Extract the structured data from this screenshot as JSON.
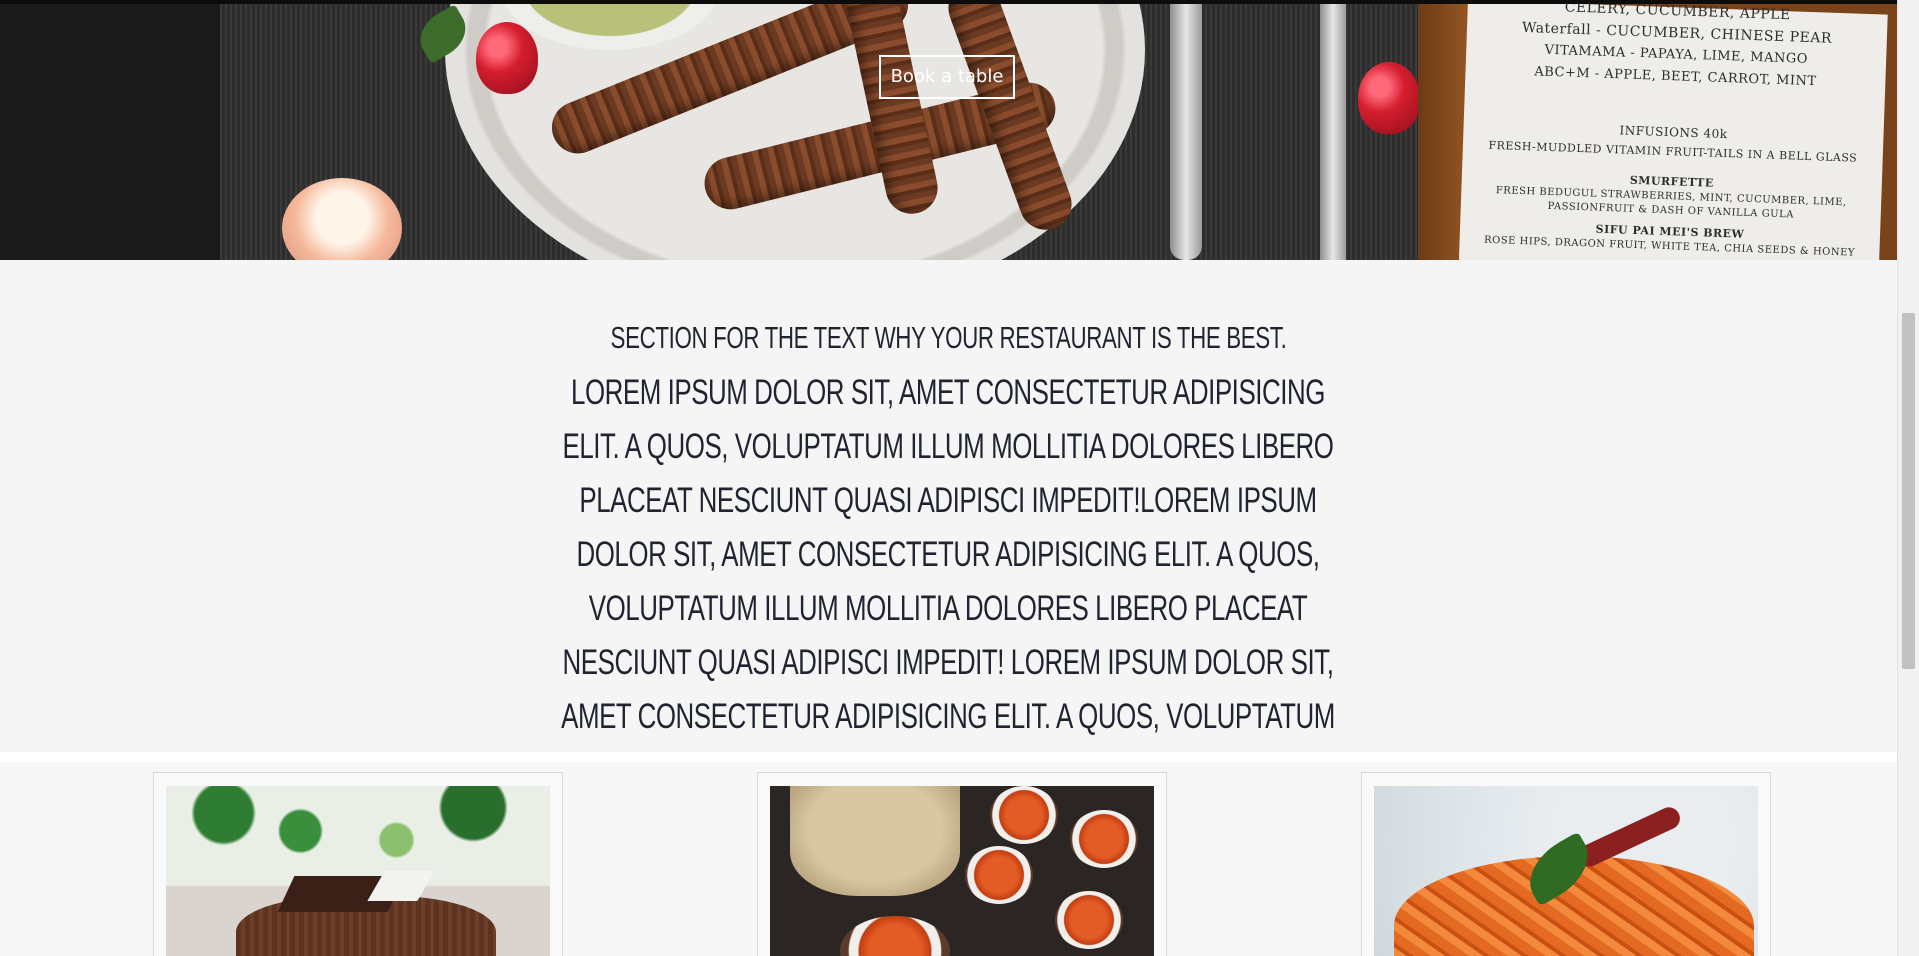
{
  "hero": {
    "book_button_label": "Book a table",
    "menu_lines": [
      "CELERY, CUCUMBER, APPLE",
      "Waterfall - CUCUMBER, CHINESE PEAR",
      "VITAMAMA - PAPAYA, LIME, MANGO",
      "ABC+M - APPLE, BEET, CARROT, MINT",
      "INFUSIONS  40k",
      "FRESH-MUDDLED VITAMIN FRUIT-TAILS IN A BELL GLASS",
      "SMURFETTE",
      "FRESH BEDUGUL STRAWBERRIES, MINT, CUCUMBER, LIME,",
      "PASSIONFRUIT & DASH OF VANILLA GULA",
      "SIFU PAI MEI'S BREW",
      "ROSE HIPS, DRAGON FRUIT, WHITE TEA, CHIA SEEDS & HONEY"
    ]
  },
  "about": {
    "heading": "Section for the text why your restaurant is the best.",
    "body": "Lorem ipsum dolor sit, amet consectetur adipisicing elit. A quos, voluptatum illum mollitia dolores libero placeat nesciunt quasi adipisci impedit!Lorem ipsum dolor sit, amet consectetur adipisicing elit. A quos, voluptatum illum mollitia dolores libero placeat nesciunt quasi adipisci impedit! Lorem ipsum dolor sit, amet consectetur adipisicing elit. A quos, voluptatum illum mollitia dolores libero placeat nesciunt quasi adipisci impedit!Lorem ipsum dolor sit."
  },
  "cards": [
    {
      "image": "chocolate-cake-photo"
    },
    {
      "image": "indian-dishes-photo"
    },
    {
      "image": "penne-pasta-photo"
    }
  ],
  "colors": {
    "section_bg": "#f5f5f5",
    "text_dark": "#1f2430",
    "button_border": "#ffffff"
  }
}
